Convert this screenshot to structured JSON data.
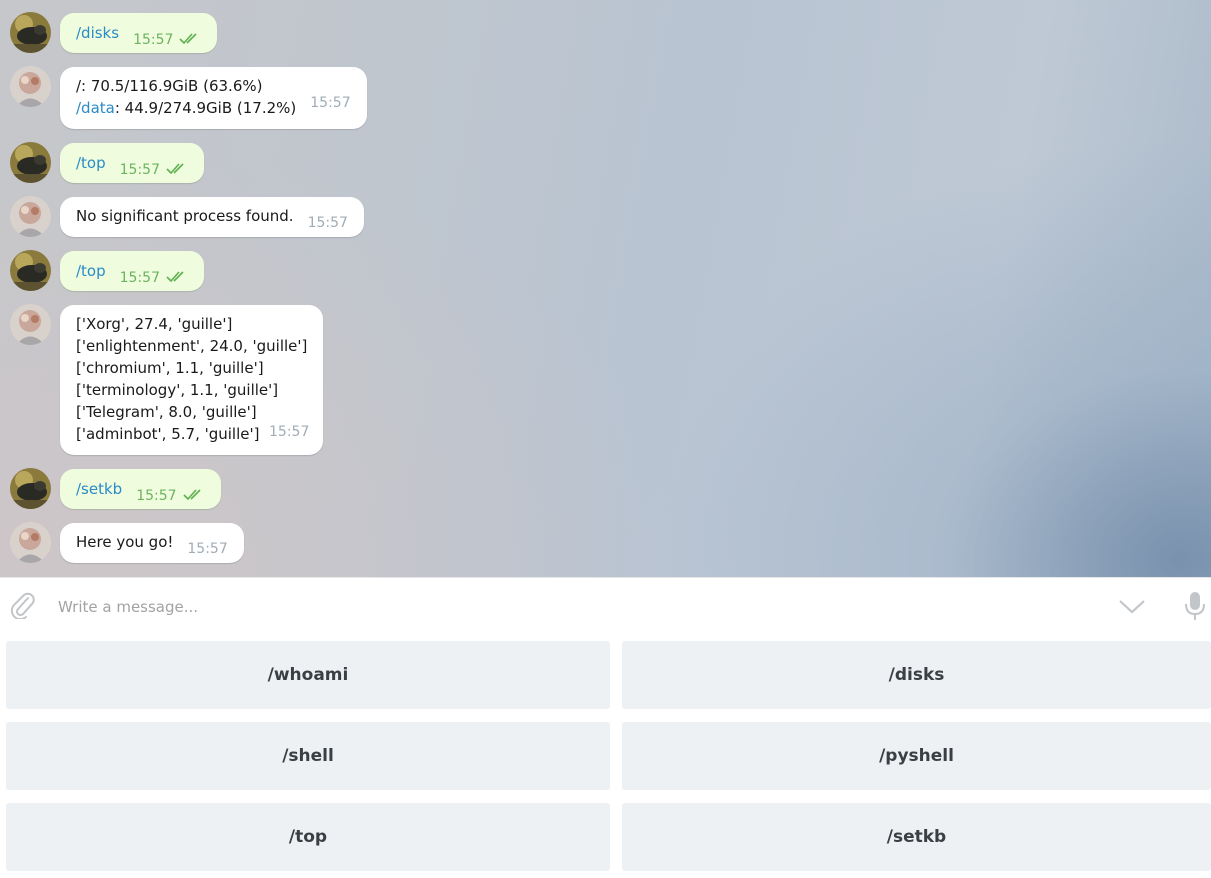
{
  "messages": [
    {
      "side": "out",
      "command": "/disks",
      "time": "15:57"
    },
    {
      "side": "in",
      "lines": [
        "/: 70.5/116.9GiB (63.6%)"
      ],
      "line2_cmd": "/data",
      "line2_rest": ": 44.9/274.9GiB (17.2%)",
      "time": "15:57"
    },
    {
      "side": "out",
      "command": "/top",
      "time": "15:57"
    },
    {
      "side": "in",
      "text": "No significant process found.",
      "time": "15:57"
    },
    {
      "side": "out",
      "command": "/top",
      "time": "15:57"
    },
    {
      "side": "in",
      "lines": [
        "['Xorg', 27.4, 'guille']",
        "['enlightenment', 24.0, 'guille']",
        "['chromium', 1.1, 'guille']",
        "['terminology', 1.1, 'guille']",
        "['Telegram', 8.0, 'guille']",
        "['adminbot', 5.7, 'guille']"
      ],
      "time": "15:57"
    },
    {
      "side": "out",
      "command": "/setkb",
      "time": "15:57"
    },
    {
      "side": "in",
      "text": "Here you go!",
      "time": "15:57"
    }
  ],
  "composer": {
    "placeholder": "Write a message...",
    "icons": [
      "paperclip-icon",
      "chevron-down-icon",
      "microphone-icon"
    ]
  },
  "keyboard": {
    "buttons": [
      "/whoami",
      "/disks",
      "/shell",
      "/pyshell",
      "/top",
      "/setkb"
    ]
  },
  "colors": {
    "outgoing_bubble": "#effdde",
    "incoming_bubble": "#ffffff",
    "command_link": "#2a8bc8",
    "outgoing_time": "#6cb35e",
    "keyboard_button": "#eef1f4"
  }
}
